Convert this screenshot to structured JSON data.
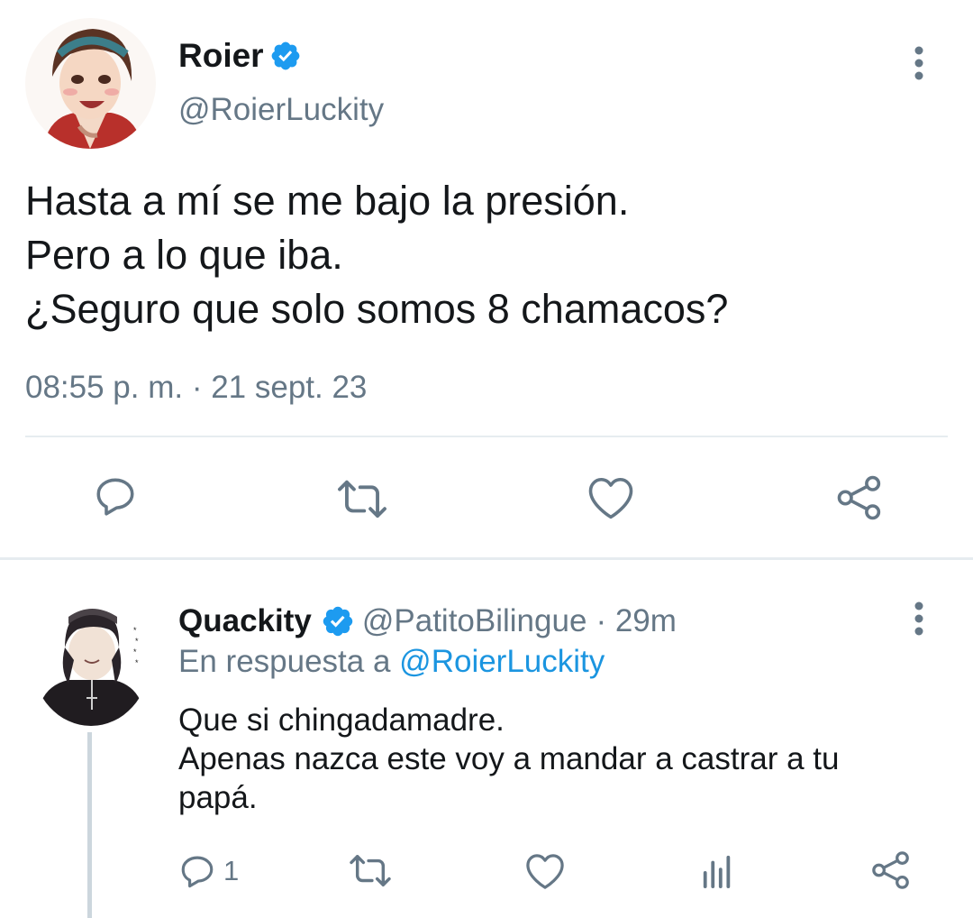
{
  "main_tweet": {
    "author_name": "Roier",
    "handle": "@RoierLuckity",
    "lines": [
      "Hasta a mí se me bajo la presión.",
      "Pero a lo que iba.",
      "¿Seguro que solo somos 8 chamacos?"
    ],
    "timestamp": "08:55 p. m. · 21 sept. 23",
    "actions": [
      "reply-icon",
      "retweet-icon",
      "like-icon",
      "share-icon"
    ]
  },
  "reply": {
    "author_name": "Quackity",
    "handle": "@PatitoBilingue",
    "time": "· 29m",
    "reply_prefix": "En respuesta a",
    "reply_to": "@RoierLuckity",
    "lines": [
      "Que si chingadamadre.",
      "Apenas nazca este voy a mandar a castrar a tu",
      "papá."
    ],
    "reply_count": "1",
    "actions": [
      "reply-icon",
      "retweet-icon",
      "like-icon",
      "analytics-icon",
      "share-icon"
    ]
  },
  "colors": {
    "verified": "#1d9bf0",
    "link": "#1b95e0",
    "muted": "#657786",
    "icon": "#657786",
    "divider": "#e1e8ed"
  }
}
